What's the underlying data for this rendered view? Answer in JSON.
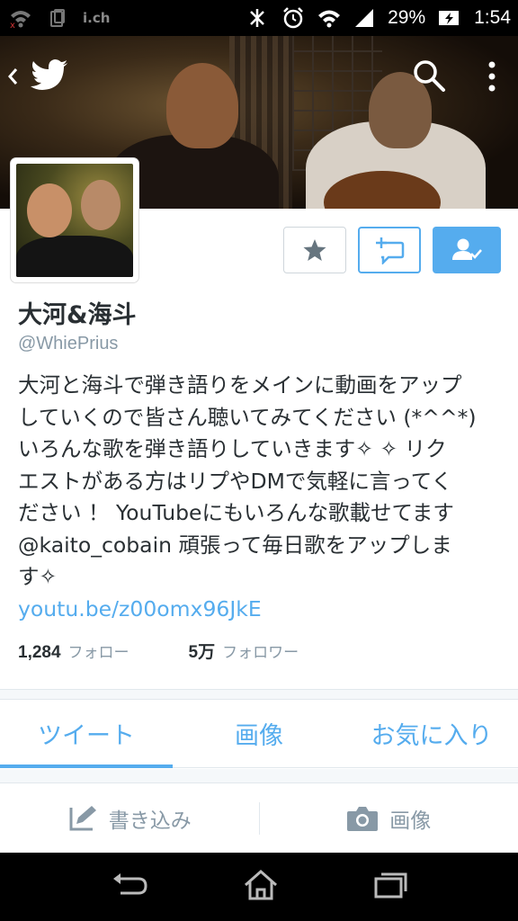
{
  "status_bar": {
    "carrier_label": "i.ch",
    "battery_percent": "29%",
    "time": "1:54"
  },
  "colors": {
    "accent": "#55acee",
    "text_primary": "#292f33",
    "text_secondary": "#8899a6"
  },
  "profile": {
    "name": "大河&海斗",
    "handle": "@WhiePrius",
    "bio_lines": [
      "大河と海斗で弾き語りをメインに動画をアップ",
      "していくので皆さん聴いてみてください (*^^*)",
      "いろんな歌を弾き語りしていきます✧ ✧ リク",
      "エストがある方はリプやDMで気軽に言ってく",
      "ださい ！ YouTubeにもいろんな歌載せてます",
      "@kaito_cobain 頑張って毎日歌をアップしま",
      "す✧"
    ],
    "link": "youtu.be/z00omx96JkE",
    "following_count": "1,284",
    "following_label": "フォロー",
    "followers_count": "5万",
    "followers_label": "フォロワー"
  },
  "tabs": [
    {
      "label": "ツイート",
      "active": true
    },
    {
      "label": "画像",
      "active": false
    },
    {
      "label": "お気に入り",
      "active": false
    }
  ],
  "compose": {
    "write_label": "書き込み",
    "image_label": "画像"
  },
  "icons": {
    "back": "back-chevron-icon",
    "logo": "twitter-bird-icon",
    "search": "search-icon",
    "more": "more-vertical-icon",
    "favorite": "star-icon",
    "reply": "reply-icon",
    "follow": "following-check-icon",
    "compose": "pencil-icon",
    "camera": "camera-icon"
  }
}
